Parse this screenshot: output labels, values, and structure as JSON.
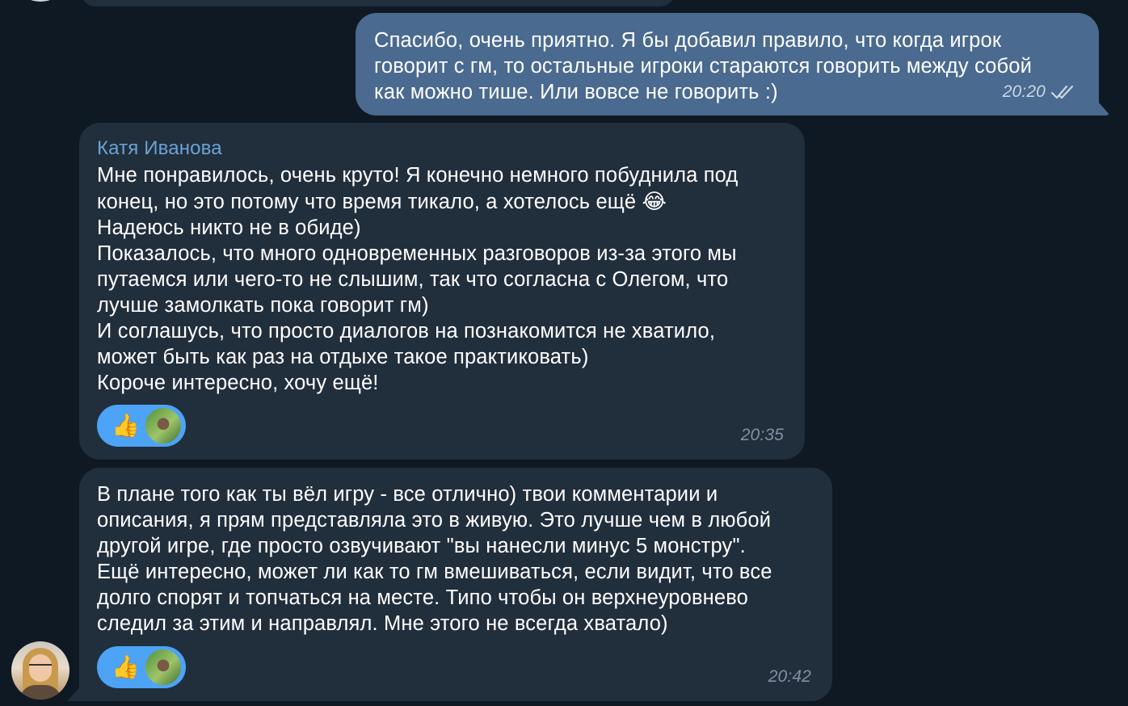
{
  "messages": [
    {
      "direction": "outgoing",
      "text": "Спасибо, очень приятно. Я бы добавил правило, что когда игрок\nговорит с гм, то остальные игроки стараются говорить между собой\nкак можно тише. Или вовсе не говорить :)",
      "time": "20:20",
      "status": "double-check-icon"
    },
    {
      "direction": "incoming",
      "sender": "Катя Иванова",
      "text_line1": "Мне понравилось, очень круто! Я конечно немного побуднила под",
      "text_line2": "конец, но это потому что время тикало, а хотелось ещё",
      "emoji": "😂",
      "text_rest": "Надеюсь никто не в обиде)\nПоказалось, что много одновременных разговоров из-за этого мы\nпутаемся или чего-то не слышим, так что согласна с Олегом, что\nлучше замолкать пока говорит гм)\nИ соглашусь, что просто диалогов на познакомится не хватило,\nможет быть как раз на отдыхе такое практиковать)\nКороче интересно, хочу ещё!",
      "reaction": "👍",
      "time": "20:35"
    },
    {
      "direction": "incoming",
      "text": "В плане того как ты вёл игру - все отлично) твои комментарии и\nописания, я прям представляла это в живую. Это лучше чем в любой\nдругой игре, где просто озвучивают \"вы нанесли минус 5 монстру\".\nЕщё интересно, может ли как то гм вмешиваться, если видит, что все\nдолго спорят и топчаться на месте. Типо чтобы он верхнеуровнево\nследил за этим и направлял. Мне этого не всегда хватало)",
      "reaction": "👍",
      "time": "20:42"
    }
  ],
  "colors": {
    "background": "#0f1923",
    "incoming_bubble": "#212e3c",
    "outgoing_bubble": "#4a6a8f",
    "sender_name": "#6aa3d6",
    "reaction_pill": "#4da3f5"
  }
}
